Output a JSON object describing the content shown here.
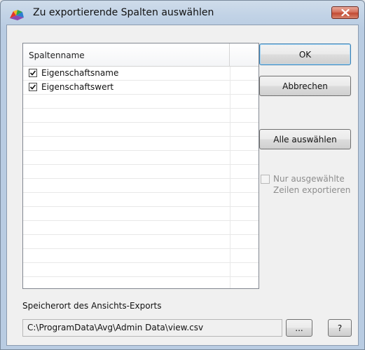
{
  "window": {
    "title": "Zu exportierende Spalten auswählen"
  },
  "columns_list": {
    "header": "Spaltenname",
    "items": [
      {
        "label": "Eigenschaftsname",
        "checked": true
      },
      {
        "label": "Eigenschaftswert",
        "checked": true
      }
    ]
  },
  "buttons": {
    "ok": "OK",
    "cancel": "Abbrechen",
    "select_all": "Alle auswählen",
    "browse": "...",
    "help": "?"
  },
  "options": {
    "export_selected_rows": "Nur ausgewählte Zeilen exportieren",
    "export_selected_rows_checked": false,
    "export_selected_rows_enabled": false
  },
  "save_location": {
    "label": "Speicherort des Ansichts-Exports",
    "path": "C:\\ProgramData\\Avg\\Admin Data\\view.csv"
  },
  "colors": {
    "accent": "#3c7fb1",
    "close_button": "#c24b33",
    "disabled_text": "#8d8d8d"
  }
}
